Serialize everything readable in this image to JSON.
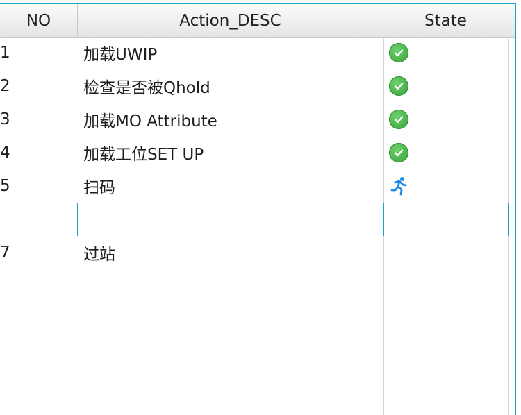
{
  "table": {
    "columns": {
      "no": "NO",
      "desc": "Action_DESC",
      "state": "State"
    },
    "rows": [
      {
        "no": "1",
        "desc": "加载UWIP",
        "state": "check-circle-icon"
      },
      {
        "no": "2",
        "desc": "检查是否被Qhold",
        "state": "check-circle-icon"
      },
      {
        "no": "3",
        "desc": "加载MO Attribute",
        "state": "check-circle-icon"
      },
      {
        "no": "4",
        "desc": "加载工位SET UP",
        "state": "check-circle-icon"
      },
      {
        "no": "5",
        "desc": "扫码",
        "state": "running-icon"
      },
      {
        "no": "",
        "desc": "",
        "state": ""
      },
      {
        "no": "7",
        "desc": "过站",
        "state": ""
      }
    ]
  },
  "colors": {
    "accent": "#17a2c8",
    "ok": "#3cb043",
    "running": "#1e88e5"
  }
}
